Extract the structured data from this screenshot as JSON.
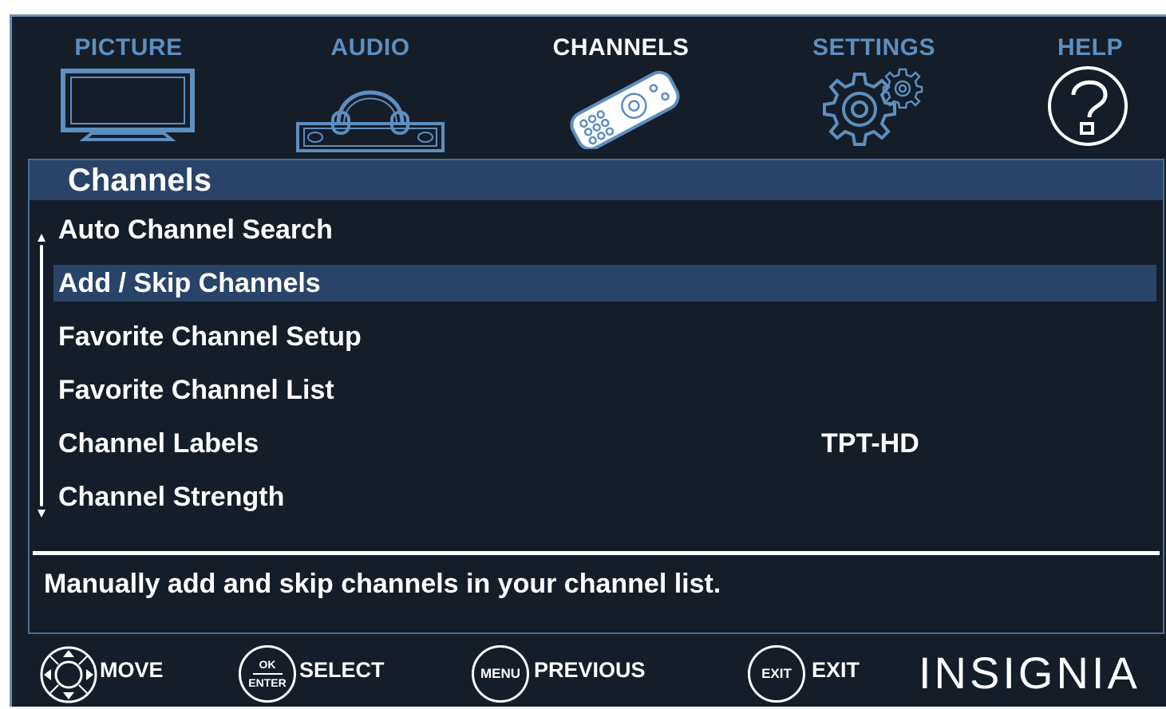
{
  "tabs": [
    {
      "id": "picture",
      "label": "PICTURE",
      "icon": "tv-icon",
      "active": false
    },
    {
      "id": "audio",
      "label": "AUDIO",
      "icon": "headphones-soundbar-icon",
      "active": false
    },
    {
      "id": "channels",
      "label": "CHANNELS",
      "icon": "remote-control-icon",
      "active": true
    },
    {
      "id": "settings",
      "label": "SETTINGS",
      "icon": "gears-icon",
      "active": false
    },
    {
      "id": "help",
      "label": "HELP",
      "icon": "question-icon",
      "active": false
    }
  ],
  "panel": {
    "title": "Channels",
    "items": [
      {
        "label": "Auto Channel Search",
        "value": "",
        "selected": false
      },
      {
        "label": "Add / Skip Channels",
        "value": "",
        "selected": true
      },
      {
        "label": "Favorite Channel Setup",
        "value": "",
        "selected": false
      },
      {
        "label": "Favorite Channel List",
        "value": "",
        "selected": false
      },
      {
        "label": "Channel Labels",
        "value": "TPT-HD",
        "selected": false
      },
      {
        "label": "Channel Strength",
        "value": "",
        "selected": false
      }
    ],
    "help_text": "Manually add and skip channels in your channel list."
  },
  "footer": {
    "move": {
      "label": "MOVE",
      "icon": "dpad-icon"
    },
    "select": {
      "label": "SELECT",
      "icon_top": "OK",
      "icon_bottom": "ENTER"
    },
    "previous": {
      "label": "PREVIOUS",
      "icon_text": "MENU"
    },
    "exit": {
      "label": "EXIT",
      "icon_text": "EXIT"
    },
    "brand": "INSIGNIA"
  },
  "colors": {
    "background": "#151d29",
    "selection": "#2a4469",
    "inactive_tab": "#5d8fbf",
    "border": "#4a6d96"
  }
}
